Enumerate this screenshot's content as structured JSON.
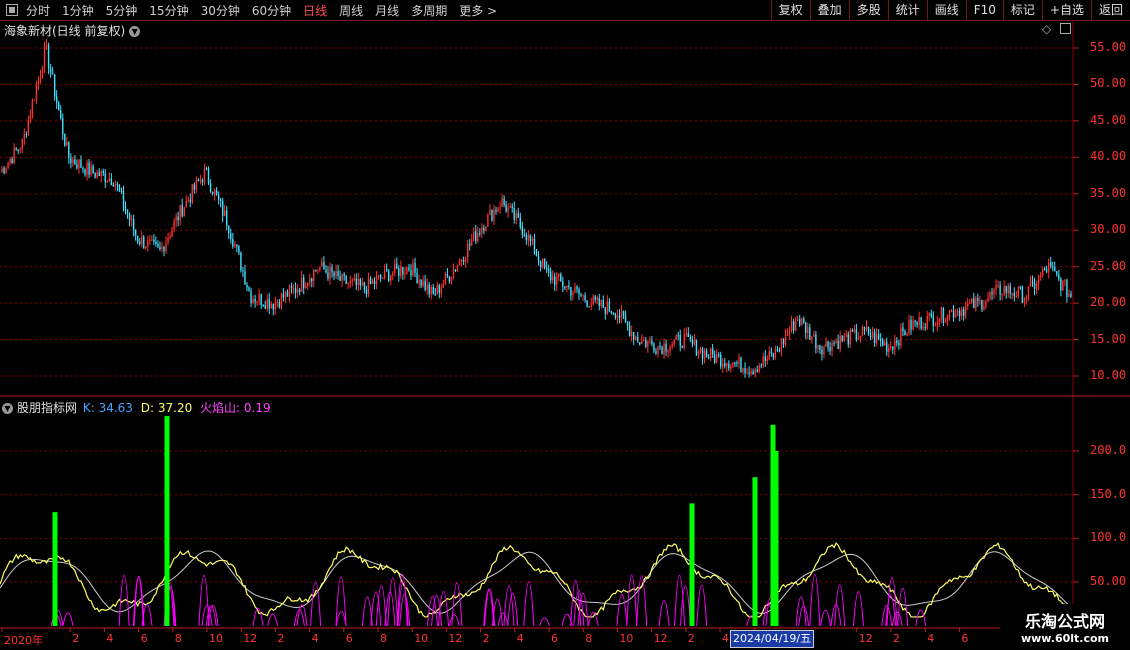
{
  "toolbar": {
    "periods": [
      "分时",
      "1分钟",
      "5分钟",
      "15分钟",
      "30分钟",
      "60分钟",
      "日线",
      "周线",
      "月线",
      "多周期",
      "更多 >"
    ],
    "active_period": "日线",
    "right_buttons": [
      "复权",
      "叠加",
      "多股",
      "统计",
      "画线",
      "F10",
      "标记",
      "+自选",
      "返回"
    ]
  },
  "main_panel": {
    "title": "海象新材(日线 前复权)",
    "y_labels": [
      "55.00",
      "50.00",
      "45.00",
      "40.00",
      "35.00",
      "30.00",
      "25.00",
      "20.00",
      "15.00",
      "10.00"
    ]
  },
  "indicator_panel": {
    "name": "股朋指标网",
    "k_label": "K: 34.63",
    "d_label": "D: 37.20",
    "fire_label": "火焰山: 0.19",
    "y_labels": [
      "200.0",
      "150.0",
      "100.0",
      "50.00"
    ]
  },
  "x_axis": {
    "labels": [
      "2020年",
      "2",
      "4",
      "6",
      "8",
      "10",
      "12",
      "2",
      "4",
      "6",
      "8",
      "10",
      "12",
      "2",
      "4",
      "6",
      "8",
      "10",
      "12",
      "2",
      "4",
      "6",
      "8",
      "10",
      "12",
      "2",
      "4",
      "6"
    ],
    "cursor_date": "2024/04/19/五"
  },
  "watermark": {
    "name": "乐淘公式网",
    "url": "www.60lt.com"
  },
  "colors": {
    "up": "#ff3030",
    "down": "#40e0ff",
    "k_line": "#ffff66",
    "d_line": "#ffffff",
    "fire": "#ff00ff",
    "bar": "#00ff00",
    "grid": "#8b0000"
  },
  "chart_data": {
    "type": "line",
    "price_series_approx": [
      38,
      42,
      55,
      40,
      38,
      37,
      29,
      27,
      33,
      38,
      31,
      21,
      20,
      22,
      25,
      23,
      22,
      24,
      25,
      21,
      25,
      30,
      34,
      30,
      24,
      22,
      20,
      19,
      15,
      14,
      15,
      13,
      12,
      11,
      13,
      18,
      14,
      15,
      16,
      14,
      17,
      18,
      19,
      20,
      22,
      21,
      25,
      21
    ],
    "indicator_bars_approx": [
      130,
      240,
      140,
      170,
      230,
      200
    ]
  }
}
